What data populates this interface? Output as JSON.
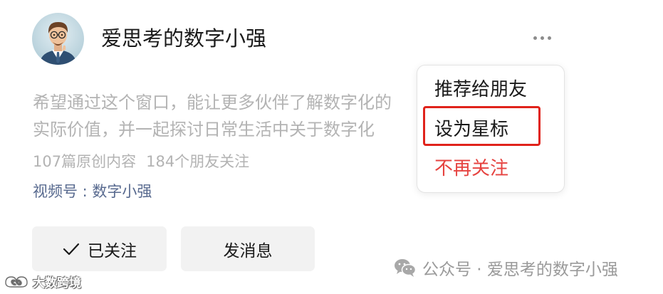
{
  "profile": {
    "name": "爱思考的数字小强",
    "description_lines": [
      "希望通过这个窗口，能让更多伙伴了解数字化的",
      "实际价值，并一起探讨日常生活中关于数字化"
    ],
    "stats": {
      "articles": "107篇原创内容",
      "followers": "184个朋友关注"
    },
    "channel": "视频号 : 数字小强"
  },
  "actions": {
    "followed_label": "已关注",
    "message_label": "发消息"
  },
  "menu": {
    "recommend": "推荐给朋友",
    "star": "设为星标",
    "unfollow": "不再关注"
  },
  "watermark": {
    "right": "公众号 · 爱思考的数字小强",
    "left": "大数跨境"
  },
  "icons": [
    "more-options-icon",
    "checkmark-icon",
    "wechat-icon",
    "watermark-logo-icon"
  ],
  "colors": {
    "danger": "#e64340",
    "highlight": "#e0231b",
    "link": "#586a8f"
  }
}
